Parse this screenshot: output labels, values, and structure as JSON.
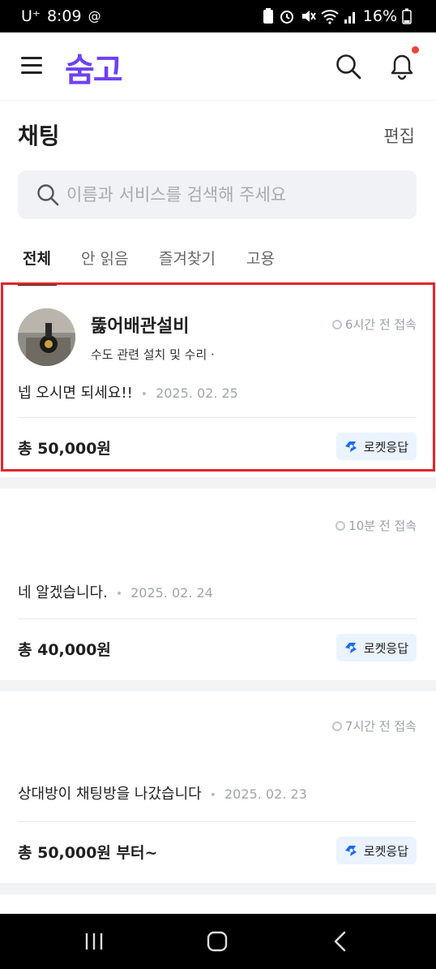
{
  "status_bar": {
    "carrier": "U⁺",
    "time": "8:09",
    "battery": "16%"
  },
  "app": {
    "logo": "숨고"
  },
  "header": {
    "title": "채팅",
    "edit_label": "편집"
  },
  "search": {
    "placeholder": "이름과 서비스를 검색해 주세요"
  },
  "tabs": [
    {
      "label": "전체",
      "active": true
    },
    {
      "label": "안 읽음",
      "active": false
    },
    {
      "label": "즐겨찾기",
      "active": false
    },
    {
      "label": "고용",
      "active": false
    }
  ],
  "chats": [
    {
      "name": "뚫어배관설비",
      "service": "수도 관련 설치 및 수리 ·",
      "last_access": "6시간 전 접속",
      "message": "넵 오시면 되세요!!",
      "date": "2025. 02. 25",
      "price": "총 50,000원",
      "badge": "로켓응답"
    },
    {
      "name": "",
      "service": "",
      "last_access": "10분 전 접속",
      "message": "네 알겠습니다.",
      "date": "2025. 02. 24",
      "price": "총 40,000원",
      "badge": "로켓응답"
    },
    {
      "name": "",
      "service": "",
      "last_access": "7시간 전 접속",
      "message": "상대방이 채팅방을 나갔습니다",
      "date": "2025. 02. 23",
      "price": "총 50,000원 부터~",
      "badge": "로켓응답"
    }
  ],
  "colors": {
    "brand": "#6e41f5",
    "highlight": "#e0262d",
    "badge_bg": "#eaf3ff",
    "badge_icon": "#1a6bf0",
    "notification": "#f0443a"
  },
  "icons": {
    "menu": "hamburger-icon",
    "search": "search-icon",
    "bell": "bell-icon",
    "rocket": "rocket-response-icon"
  }
}
